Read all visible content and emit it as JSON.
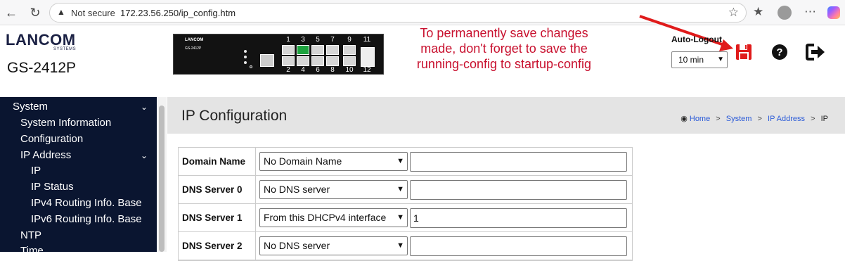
{
  "browser": {
    "not_secure": "Not secure",
    "url": "172.23.56.250/ip_config.htm"
  },
  "header": {
    "logo": "LANCOM",
    "logo_sub": "SYSTEMS",
    "model": "GS-2412P",
    "switch_brand": "LANCOM",
    "switch_model": "GS-2412P",
    "ports_top": [
      "1",
      "3",
      "5",
      "7",
      "9",
      "11"
    ],
    "ports_bottom": [
      "2",
      "4",
      "6",
      "8",
      "10",
      "12"
    ],
    "note": "To permanently save changes made, don't forget to save the running-config to startup-config",
    "autologout_label": "Auto-Logout",
    "autologout_value": "10 min"
  },
  "sidebar": {
    "items": [
      {
        "label": "System",
        "level": 0,
        "expanded": true
      },
      {
        "label": "System Information",
        "level": 1
      },
      {
        "label": "Configuration",
        "level": 1
      },
      {
        "label": "IP Address",
        "level": 1,
        "expanded": true
      },
      {
        "label": "IP",
        "level": 2
      },
      {
        "label": "IP Status",
        "level": 2
      },
      {
        "label": "IPv4 Routing Info. Base",
        "level": 2
      },
      {
        "label": "IPv6 Routing Info. Base",
        "level": 2
      },
      {
        "label": "NTP",
        "level": 1
      },
      {
        "label": "Time",
        "level": 1
      }
    ]
  },
  "main": {
    "title": "IP Configuration",
    "breadcrumb": [
      "Home",
      "System",
      "IP Address",
      "IP"
    ],
    "rows": [
      {
        "label": "Domain Name",
        "select": "No Domain Name",
        "value": ""
      },
      {
        "label": "DNS Server 0",
        "select": "No DNS server",
        "value": ""
      },
      {
        "label": "DNS Server 1",
        "select": "From this DHCPv4 interface",
        "value": "1"
      },
      {
        "label": "DNS Server 2",
        "select": "No DNS server",
        "value": ""
      }
    ]
  },
  "colors": {
    "accent_red": "#c8102e",
    "sidebar_bg": "#0a1530",
    "link_blue": "#2b5bd8",
    "port_active": "#1ea33f"
  }
}
